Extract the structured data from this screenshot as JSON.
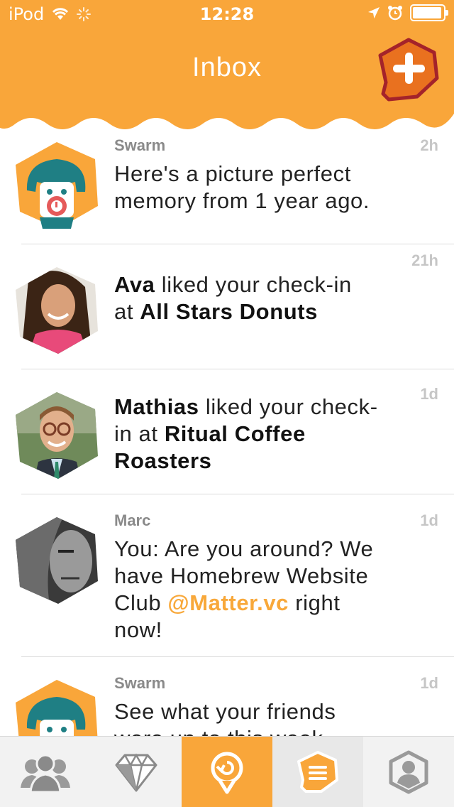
{
  "status": {
    "carrier": "iPod",
    "time": "12:28"
  },
  "header": {
    "title": "Inbox"
  },
  "colors": {
    "brand_orange": "#f9a63a",
    "compose_red": "#a4232a",
    "text_gray": "#8a8a8a"
  },
  "messages": [
    {
      "sender": "Swarm",
      "time": "2h",
      "line1": "Here's a picture perfect",
      "line2": "memory from 1 year ago."
    },
    {
      "sender": "",
      "time": "21h",
      "name": "Ava",
      "text_a": " liked your check-in",
      "text_b": "at ",
      "venue": "All Stars Donuts"
    },
    {
      "sender": "",
      "time": "1d",
      "name": "Mathias",
      "text_a": " liked your check-",
      "text_b": "in at ",
      "venue": "Ritual Coffee",
      "venue2": "Roasters"
    },
    {
      "sender": "Marc",
      "time": "1d",
      "line1": "You: Are you around? We",
      "line2": "have Homebrew Website",
      "line3a": "Club ",
      "mention": "@Matter.vc",
      "line3b": " right",
      "line4": "now!"
    },
    {
      "sender": "Swarm",
      "time": "1d",
      "line1": "See what your friends",
      "line2": "were up to this week"
    }
  ],
  "tabs": [
    {
      "icon": "friends-icon"
    },
    {
      "icon": "diamond-icon"
    },
    {
      "icon": "checkin-icon"
    },
    {
      "icon": "inbox-icon"
    },
    {
      "icon": "profile-icon"
    }
  ]
}
